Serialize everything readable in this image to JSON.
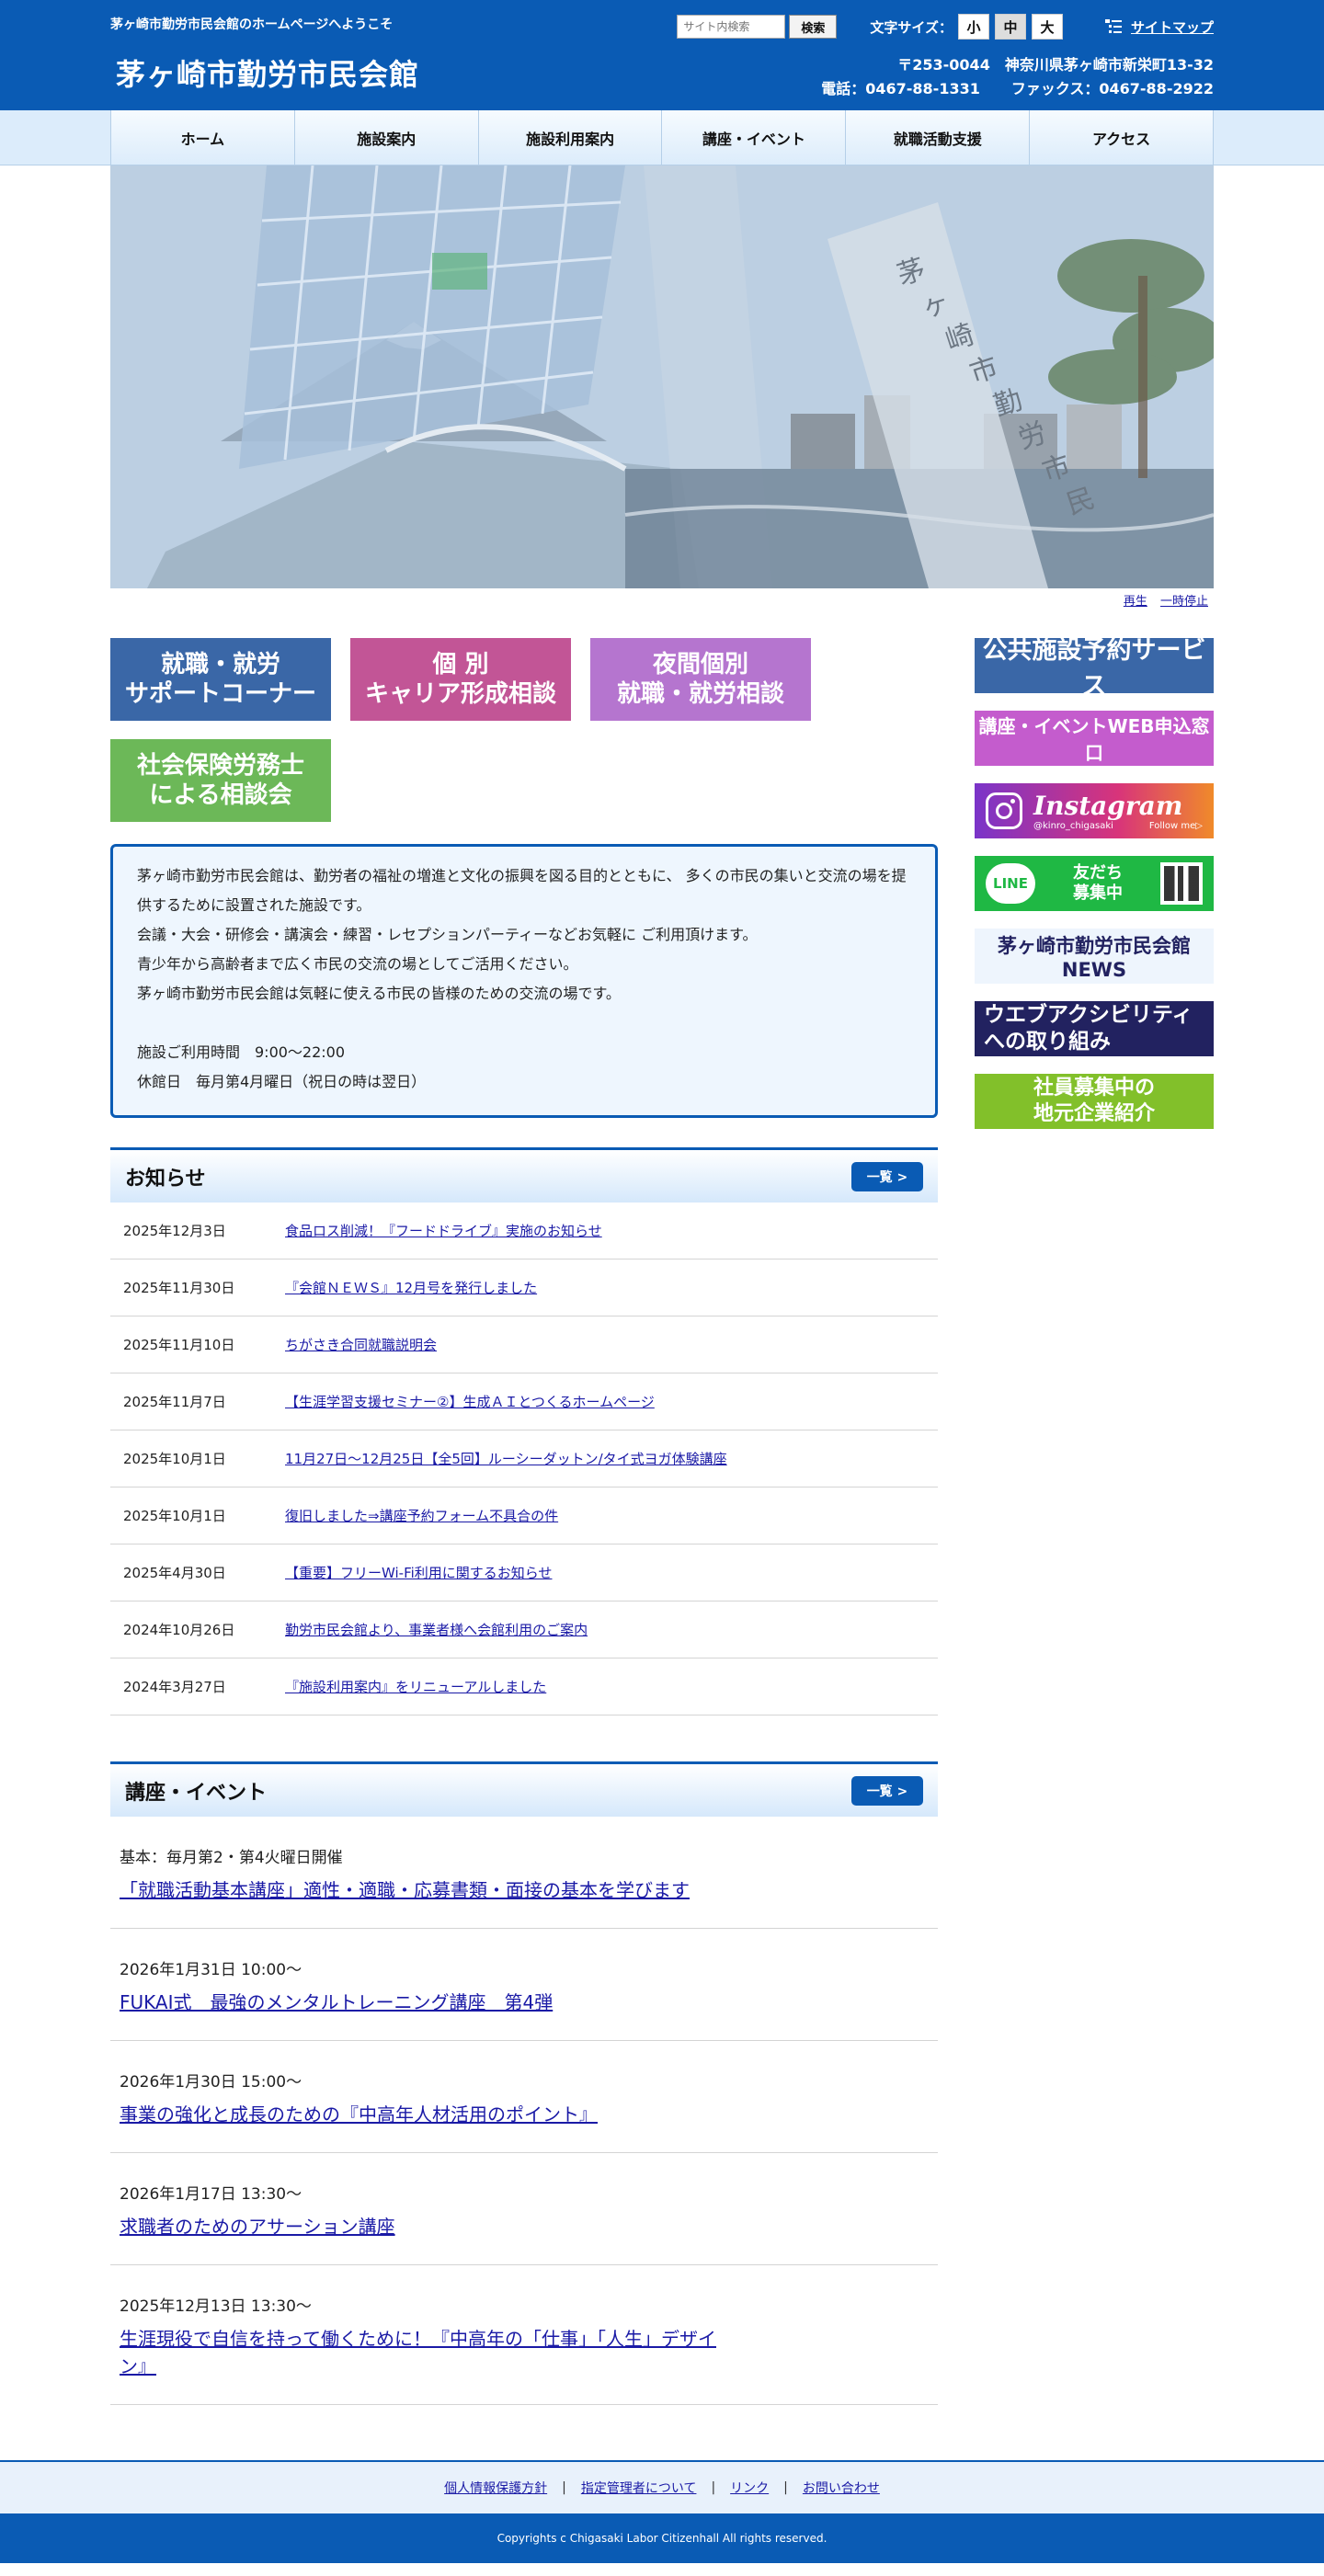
{
  "header": {
    "welcome": "茅ヶ崎市勤労市民会館のホームページへようこそ",
    "site_title": "茅ヶ崎市勤労市民会館",
    "search_placeholder": "サイト内検索",
    "search_button": "検索",
    "font_size_label": "文字サイズ：",
    "font_sizes": [
      "小",
      "中",
      "大"
    ],
    "sitemap": "サイトマップ",
    "address": "〒253-0044　神奈川県茅ヶ崎市新栄町13-32",
    "tel": "電話：0467-88-1331",
    "fax": "ファックス：0467-88-2922"
  },
  "nav": [
    "ホーム",
    "施設案内",
    "施設利用案内",
    "講座・イベント",
    "就職活動支援",
    "アクセス"
  ],
  "hero": {
    "building_sign": "茅ヶ崎市勤労市民会館",
    "play": "再生",
    "pause": "一時停止"
  },
  "banners": [
    "就職・就労\nサポートコーナー",
    "個 別\nキャリア形成相談",
    "夜間個別\n就職・就労相談",
    "社会保険労務士\nによる相談会"
  ],
  "intro": {
    "text": "茅ヶ崎市勤労市民会館は、勤労者の福祉の増進と文化の振興を図る目的とともに、 多くの市民の集いと交流の場を提供するために設置された施設です。\n会議・大会・研修会・講演会・練習・レセプションパーティーなどお気軽に ご利用頂けます。\n青少年から高齢者まで広く市民の交流の場としてご活用ください。\n茅ヶ崎市勤労市民会館は気軽に使える市民の皆様のための交流の場です。",
    "hours": "施設ご利用時間　9:00～22:00",
    "closed": "休館日　毎月第4月曜日（祝日の時は翌日）"
  },
  "news": {
    "title": "お知らせ",
    "more": "一覧 >",
    "items": [
      {
        "date": "2025年12月3日",
        "title": "食品ロス削減！『フードドライブ』実施のお知らせ"
      },
      {
        "date": "2025年11月30日",
        "title": "『会館ＮＥＷＳ』12月号を発行しました"
      },
      {
        "date": "2025年11月10日",
        "title": "ちがさき合同就職説明会"
      },
      {
        "date": "2025年11月7日",
        "title": "【生涯学習支援セミナー②】生成ＡＩとつくるホームページ"
      },
      {
        "date": "2025年10月1日",
        "title": "11月27日～12月25日【全5回】ルーシーダットン/タイ式ヨガ体験講座"
      },
      {
        "date": "2025年10月1日",
        "title": "復旧しました⇒講座予約フォーム不具合の件"
      },
      {
        "date": "2025年4月30日",
        "title": "【重要】フリーWi-Fi利用に関するお知らせ"
      },
      {
        "date": "2024年10月26日",
        "title": "勤労市民会館より、事業者様へ会館利用のご案内"
      },
      {
        "date": "2024年3月27日",
        "title": "『施設利用案内』をリニューアルしました"
      }
    ]
  },
  "events": {
    "title": "講座・イベント",
    "more": "一覧 >",
    "items": [
      {
        "when": "基本：毎月第2・第4火曜日開催",
        "title": "「就職活動基本講座」適性・適職・応募書類・面接の基本を学びます"
      },
      {
        "when": "2026年1月31日 10:00～",
        "title": "FUKAI式　最強のメンタルトレーニング講座　第4弾"
      },
      {
        "when": "2026年1月30日 15:00～",
        "title": "事業の強化と成長のための『中高年人材活用のポイント』"
      },
      {
        "when": "2026年1月17日 13:30～",
        "title": "求職者のためのアサーション講座"
      },
      {
        "when": "2025年12月13日 13:30～",
        "title": "生涯現役で自信を持って働くために！『中高年の「仕事」「人生」デザイン』"
      }
    ]
  },
  "side": {
    "reserve": "公共施設予約サービス",
    "web_apply": "講座・イベントWEB申込窓口",
    "instagram": "Instagram",
    "instagram_handle": "@kinro_chigasaki",
    "instagram_follow": "Follow me▷",
    "line_logo": "LINE",
    "line_text": "友だち\n募集中",
    "news": "茅ヶ崎市勤労市民会館NEWS",
    "accessibility": "ウエブアクシビリティ\nへの取り組み",
    "recruit": "社員募集中の\n地元企業紹介"
  },
  "footer": {
    "links": [
      "個人情報保護方針",
      "指定管理者について",
      "リンク",
      "お問い合わせ"
    ],
    "copyright": "Copyrights c Chigasaki Labor Citizenhall All rights reserved."
  }
}
